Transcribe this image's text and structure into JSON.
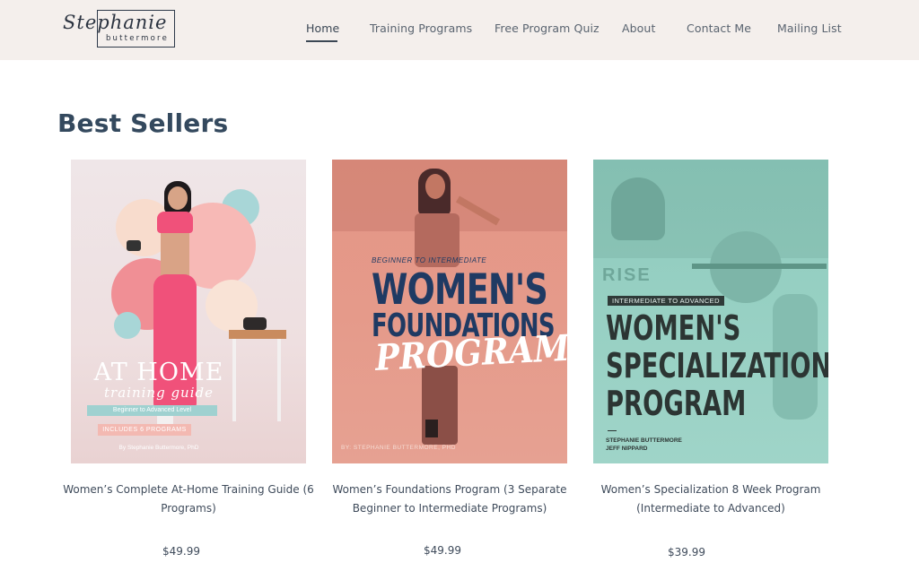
{
  "header": {
    "logo": {
      "script": "Stephanie",
      "sub": "buttermore"
    },
    "nav": [
      {
        "label": "Home",
        "active": true
      },
      {
        "label": "Training Programs",
        "active": false
      },
      {
        "label": "Free Program Quiz",
        "active": false
      },
      {
        "label": "About",
        "active": false
      },
      {
        "label": "Contact Me",
        "active": false
      },
      {
        "label": "Mailing List",
        "active": false
      }
    ]
  },
  "main": {
    "section_title": "Best Sellers",
    "products": [
      {
        "title": "Women’s Complete At-Home Training Guide (6 Programs)",
        "price": "$49.99",
        "cover": {
          "line1": "AT HOME",
          "line2": "training guide",
          "level": "Beginner to Advanced Level",
          "badge": "INCLUDES 6 PROGRAMS",
          "byline": "By Stephanie Buttermore, PhD"
        }
      },
      {
        "title": "Women’s Foundations Program (3 Separate Beginner to Intermediate Programs)",
        "price": "$49.99",
        "cover": {
          "eyebrow": "BEGINNER TO INTERMEDIATE",
          "line1": "WOMEN'S",
          "line2": "FOUNDATIONS",
          "line3": "PROGRAM",
          "byline": "BY: STEPHANIE BUTTERMORE, PHD"
        }
      },
      {
        "title": "Women’s Specialization 8 Week Program (Intermediate to Advanced)",
        "price": "$39.99",
        "cover": {
          "brand": "RISE",
          "tag": "INTERMEDIATE TO ADVANCED",
          "line1": "WOMEN'S",
          "line2": "SPECIALIZATION",
          "line3": "PROGRAM",
          "author1": "STEPHANIE BUTTERMORE",
          "author2": "JEFF NIPPARD"
        }
      }
    ]
  },
  "colors": {
    "header_bg": "#f4efec",
    "title": "#34495e",
    "cover1_pink": "#f0517a",
    "cover2_bg": "#e49586",
    "cover2_navy": "#1f3a63",
    "cover3_bg": "#97d0c3"
  }
}
